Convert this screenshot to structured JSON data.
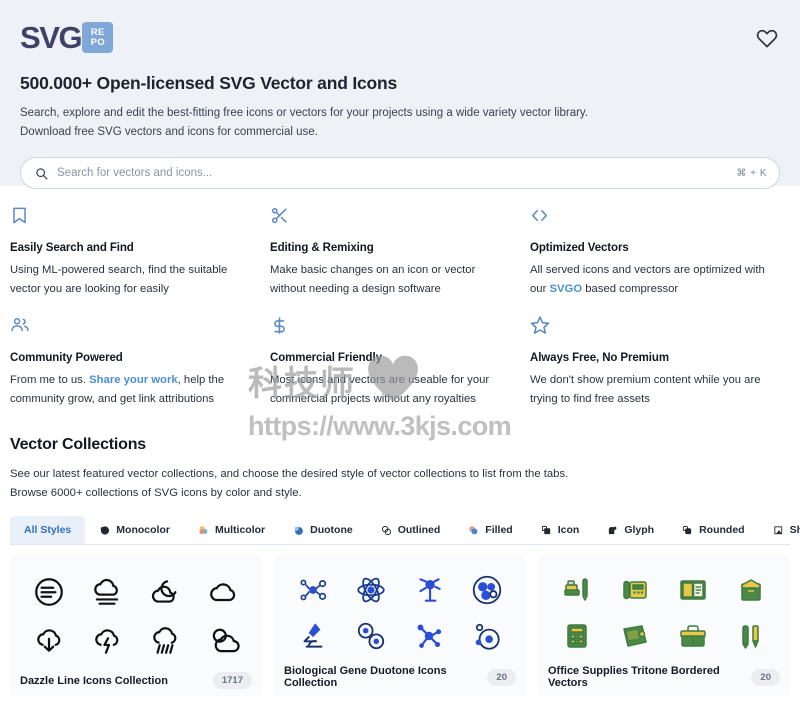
{
  "header": {
    "logo_word": "SVG",
    "logo_badge_line1": "RE",
    "logo_badge_line2": "PO",
    "favorites_icon": "heart-icon",
    "title": "500.000+ Open-licensed SVG Vector and Icons",
    "subtitle_line1": "Search, explore and edit the best-fitting free icons or vectors for your projects using a wide variety vector library.",
    "subtitle_line2": "Download free SVG vectors and icons for commercial use.",
    "background_color": "#eef1f6"
  },
  "search": {
    "placeholder": "Search for vectors and icons...",
    "value": "",
    "shortcut": "⌘ + K",
    "icon": "search-icon"
  },
  "features": [
    {
      "icon": "bookmark-icon",
      "title": "Easily Search and Find",
      "body_before": "Using ML-powered search, find the suitable vector you are looking for easily",
      "link": "",
      "body_after": ""
    },
    {
      "icon": "scissors-icon",
      "title": "Editing & Remixing",
      "body_before": "Make basic changes on an icon or vector without needing a design software",
      "link": "",
      "body_after": ""
    },
    {
      "icon": "code-brackets-icon",
      "title": "Optimized Vectors",
      "body_before": "All served icons and vectors are optimized with our ",
      "link": "SVGO",
      "body_after": " based compressor"
    },
    {
      "icon": "people-icon",
      "title": "Community Powered",
      "body_before": "From me to us. ",
      "link": "Share your work",
      "body_after": ", help the community grow, and get link attributions"
    },
    {
      "icon": "dollar-icon",
      "title": "Commercial Friendly",
      "body_before": "Most icons and vectors are useable for your commercial projects without any royalties",
      "link": "",
      "body_after": ""
    },
    {
      "icon": "star-icon",
      "title": "Always Free, No Premium",
      "body_before": "We don't show premium content while you are trying to find free assets",
      "link": "",
      "body_after": ""
    }
  ],
  "collections": {
    "heading": "Vector Collections",
    "sub_line1": "See our latest featured vector collections, and choose the desired style of vector collections to list from the tabs.",
    "sub_line2": "Browse 6000+ collections of SVG icons by color and style.",
    "tabs": [
      {
        "label": "All Styles",
        "icon": "none",
        "active": true
      },
      {
        "label": "Monocolor",
        "icon": "monocolor-icon",
        "active": false
      },
      {
        "label": "Multicolor",
        "icon": "multicolor-icon",
        "active": false
      },
      {
        "label": "Duotone",
        "icon": "duotone-icon",
        "active": false
      },
      {
        "label": "Outlined",
        "icon": "outlined-icon",
        "active": false
      },
      {
        "label": "Filled",
        "icon": "filled-icon",
        "active": false
      },
      {
        "label": "Icon",
        "icon": "icon-style-icon",
        "active": false
      },
      {
        "label": "Glyph",
        "icon": "glyph-icon",
        "active": false
      },
      {
        "label": "Rounded",
        "icon": "rounded-icon",
        "active": false
      },
      {
        "label": "Sharp",
        "icon": "sharp-icon",
        "active": false
      }
    ],
    "cards": [
      {
        "title": "Dazzle Line Icons Collection",
        "count": "1717",
        "style": "line",
        "icons": [
          "wind-circle-icon",
          "fog-cloud-icon",
          "moon-cloud-icon",
          "cloud-icon",
          "cloud-download-icon",
          "cloud-lightning-icon",
          "rain-cloud-icon",
          "clouds-icon"
        ]
      },
      {
        "title": "Biological Gene Duotone Icons Collection",
        "count": "20",
        "style": "duotone-blue",
        "icons": [
          "molecule-icon",
          "atom-icon",
          "neuron-icon",
          "cell-cluster-icon",
          "microscope-icon",
          "cell-pair-icon",
          "molecule-branch-icon",
          "cell-orbit-icon"
        ]
      },
      {
        "title": "Office Supplies Tritone Bordered Vectors",
        "count": "20",
        "style": "tritone-green",
        "icons": [
          "stapler-pen-icon",
          "desk-phone-icon",
          "open-book-icon",
          "envelope-icon",
          "calculator-icon",
          "wallet-icon",
          "briefcase-icon",
          "pens-icon"
        ]
      }
    ]
  },
  "watermark": {
    "text_cn": "科技师",
    "heart": "heart-solid-icon",
    "url": "https://www.3kjs.com"
  }
}
